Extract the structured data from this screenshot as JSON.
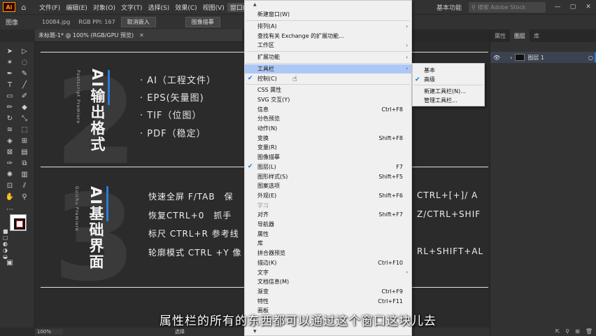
{
  "app": {
    "logo": "Ai",
    "home_icon": "home-icon"
  },
  "menubar": [
    "文件(F)",
    "编辑(E)",
    "对象(O)",
    "文字(T)",
    "选择(S)",
    "效果(C)",
    "视图(V)",
    "窗口(W)"
  ],
  "workspace": "基本功能",
  "stock_search": {
    "placeholder": "搜索 Adobe Stock"
  },
  "control": {
    "label": "图像",
    "filename": "10084.jpg",
    "colorinfo": "RGB PPI: 167",
    "btn_embed": "取消嵌入",
    "btn_trace": "图像描摹"
  },
  "doc_tab": "未标题-1* @ 100% (RGB/GPU 预览)",
  "canvas": {
    "section2": {
      "number": "2",
      "title": "AI输出格式",
      "sub": "Postscript Premiere",
      "bullets": [
        "· AI（工程文件）",
        "· EPS(矢量图)",
        "· TIF（位图）",
        "· PDF（稳定）"
      ]
    },
    "section3": {
      "number": "3",
      "title": "AI基础界面",
      "sub": "Guichu Premiere",
      "shortcuts": [
        "快速全屏 F/TAB　保",
        "恢复CTRL+0　抓手",
        "标尺 CTRL+R 参考线",
        "轮廓模式 CTRL +Y 像"
      ],
      "shortcuts_right": [
        "CTRL+[+]/ A",
        "Z/CTRL+SHIF",
        "",
        "RL+SHIFT+AL"
      ]
    }
  },
  "status": {
    "zoom": "100%",
    "tool": "选择"
  },
  "right_panel": {
    "tabs": [
      "属性",
      "图层",
      "库"
    ],
    "layer": "图层 1"
  },
  "menu": {
    "items": [
      {
        "label": "新建窗口(W)",
        "shortcut": "",
        "arrow": false,
        "checked": false,
        "dim": false
      },
      {
        "sep": true
      },
      {
        "label": "排列(A)",
        "shortcut": "",
        "arrow": true,
        "checked": false,
        "dim": false
      },
      {
        "label": "查找有关 Exchange 的扩展功能...",
        "shortcut": "",
        "arrow": false,
        "checked": false,
        "dim": false
      },
      {
        "label": "工作区",
        "shortcut": "",
        "arrow": true,
        "checked": false,
        "dim": false
      },
      {
        "sep": true
      },
      {
        "label": "扩展功能",
        "shortcut": "",
        "arrow": true,
        "checked": false,
        "dim": false
      },
      {
        "sep": true
      },
      {
        "label": "工具栏",
        "shortcut": "",
        "arrow": true,
        "checked": false,
        "dim": false,
        "highlight": true
      },
      {
        "label": "控制(C)",
        "shortcut": "",
        "arrow": false,
        "checked": true,
        "dim": false
      },
      {
        "sep": true
      },
      {
        "label": "CSS 属性",
        "shortcut": "",
        "arrow": false,
        "checked": false,
        "dim": false
      },
      {
        "label": "SVG 交互(Y)",
        "shortcut": "",
        "arrow": false,
        "checked": false,
        "dim": false
      },
      {
        "label": "信息",
        "shortcut": "Ctrl+F8",
        "arrow": false,
        "checked": false,
        "dim": false
      },
      {
        "label": "分色预览",
        "shortcut": "",
        "arrow": false,
        "checked": false,
        "dim": false
      },
      {
        "label": "动作(N)",
        "shortcut": "",
        "arrow": false,
        "checked": false,
        "dim": false
      },
      {
        "label": "变换",
        "shortcut": "Shift+F8",
        "arrow": false,
        "checked": false,
        "dim": false
      },
      {
        "label": "变量(R)",
        "shortcut": "",
        "arrow": false,
        "checked": false,
        "dim": false
      },
      {
        "label": "图像描摹",
        "shortcut": "",
        "arrow": false,
        "checked": false,
        "dim": false
      },
      {
        "label": "图层(L)",
        "shortcut": "F7",
        "arrow": false,
        "checked": true,
        "dim": false
      },
      {
        "label": "图形样式(S)",
        "shortcut": "Shift+F5",
        "arrow": false,
        "checked": false,
        "dim": false
      },
      {
        "label": "图案选项",
        "shortcut": "",
        "arrow": false,
        "checked": false,
        "dim": false
      },
      {
        "label": "外观(E)",
        "shortcut": "Shift+F6",
        "arrow": false,
        "checked": false,
        "dim": false
      },
      {
        "label": "学习",
        "shortcut": "",
        "arrow": false,
        "checked": false,
        "dim": true
      },
      {
        "label": "对齐",
        "shortcut": "Shift+F7",
        "arrow": false,
        "checked": false,
        "dim": false
      },
      {
        "label": "导航器",
        "shortcut": "",
        "arrow": false,
        "checked": false,
        "dim": false
      },
      {
        "label": "属性",
        "shortcut": "",
        "arrow": false,
        "checked": false,
        "dim": false
      },
      {
        "label": "库",
        "shortcut": "",
        "arrow": false,
        "checked": false,
        "dim": false
      },
      {
        "label": "拼合器预览",
        "shortcut": "",
        "arrow": false,
        "checked": false,
        "dim": false
      },
      {
        "label": "描边(K)",
        "shortcut": "Ctrl+F10",
        "arrow": false,
        "checked": false,
        "dim": false
      },
      {
        "label": "文字",
        "shortcut": "",
        "arrow": true,
        "checked": false,
        "dim": false
      },
      {
        "label": "文档信息(M)",
        "shortcut": "",
        "arrow": false,
        "checked": false,
        "dim": false
      },
      {
        "label": "渐变",
        "shortcut": "Ctrl+F9",
        "arrow": false,
        "checked": false,
        "dim": false
      },
      {
        "label": "特性",
        "shortcut": "Ctrl+F11",
        "arrow": false,
        "checked": false,
        "dim": false
      },
      {
        "label": "画板",
        "shortcut": "",
        "arrow": false,
        "checked": false,
        "dim": false
      }
    ]
  },
  "submenu": {
    "items": [
      {
        "label": "基本",
        "checked": false,
        "highlight": false
      },
      {
        "label": "高级",
        "checked": true,
        "highlight": false
      },
      {
        "sep": true
      },
      {
        "label": "新建工具栏(N)...",
        "checked": false,
        "highlight": false
      },
      {
        "label": "管理工具栏...",
        "checked": false,
        "highlight": false
      }
    ]
  },
  "subtitle": "属性栏的所有的东西都可以通过这个窗口这块儿去",
  "colors": {
    "accent": "#2a7bd8",
    "menu_bg": "#f0f0f0",
    "menu_highlight": "#aec8f5",
    "ui_dark": "#323232"
  }
}
